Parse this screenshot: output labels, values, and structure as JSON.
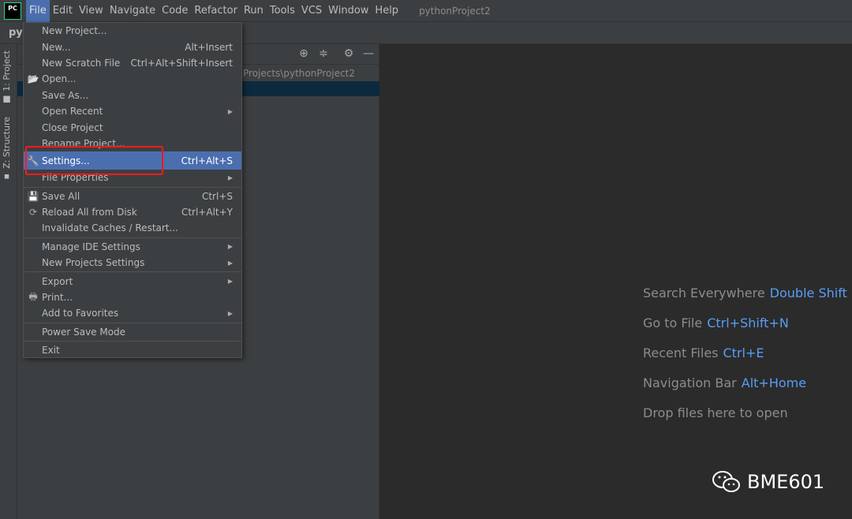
{
  "app": {
    "logo": "PC",
    "title": "pythonProject2",
    "nav_text": "py"
  },
  "menubar": [
    "File",
    "Edit",
    "View",
    "Navigate",
    "Code",
    "Refactor",
    "Run",
    "Tools",
    "VCS",
    "Window",
    "Help"
  ],
  "sidebar": {
    "tabs": [
      {
        "label": "1: Project",
        "icon": "folder-icon"
      },
      {
        "label": "Z: Structure",
        "icon": "structure-icon"
      }
    ]
  },
  "project_panel": {
    "path": "Projects\\pythonProject2",
    "icons": [
      "locate-icon",
      "collapse-icon",
      "gear-icon",
      "minimize-icon"
    ]
  },
  "file_menu": {
    "items": [
      {
        "label": "New Project...",
        "shortcut": ""
      },
      {
        "label": "New...",
        "shortcut": "Alt+Insert"
      },
      {
        "label": "New Scratch File",
        "shortcut": "Ctrl+Alt+Shift+Insert"
      },
      {
        "label": "Open...",
        "shortcut": "",
        "icon": "folder-open-icon"
      },
      {
        "label": "Save As...",
        "shortcut": ""
      },
      {
        "label": "Open Recent",
        "shortcut": "",
        "submenu": true
      },
      {
        "label": "Close Project",
        "shortcut": ""
      },
      {
        "label": "Rename Project...",
        "shortcut": ""
      },
      {
        "label": "Settings...",
        "shortcut": "Ctrl+Alt+S",
        "icon": "wrench-icon",
        "selected": true
      },
      {
        "label": "File Properties",
        "shortcut": "",
        "submenu": true
      },
      {
        "label": "Save All",
        "shortcut": "Ctrl+S",
        "icon": "save-icon"
      },
      {
        "label": "Reload All from Disk",
        "shortcut": "Ctrl+Alt+Y",
        "icon": "reload-icon"
      },
      {
        "label": "Invalidate Caches / Restart...",
        "shortcut": ""
      },
      {
        "label": "Manage IDE Settings",
        "shortcut": "",
        "submenu": true
      },
      {
        "label": "New Projects Settings",
        "shortcut": "",
        "submenu": true
      },
      {
        "label": "Export",
        "shortcut": "",
        "submenu": true
      },
      {
        "label": "Print...",
        "shortcut": "",
        "icon": "print-icon"
      },
      {
        "label": "Add to Favorites",
        "shortcut": "",
        "submenu": true
      },
      {
        "label": "Power Save Mode",
        "shortcut": ""
      },
      {
        "label": "Exit",
        "shortcut": ""
      }
    ],
    "separators_after": [
      9,
      12,
      14,
      17,
      18
    ]
  },
  "hints": [
    {
      "label": "Search Everywhere",
      "key": "Double Shift"
    },
    {
      "label": "Go to File",
      "key": "Ctrl+Shift+N"
    },
    {
      "label": "Recent Files",
      "key": "Ctrl+E"
    },
    {
      "label": "Navigation Bar",
      "key": "Alt+Home"
    },
    {
      "label": "Drop files here to open",
      "key": ""
    }
  ],
  "watermark": "BME601",
  "colors": {
    "accent": "#4b6eaf",
    "shortcut": "#589df6",
    "highlight_box": "#ff1a1a"
  }
}
